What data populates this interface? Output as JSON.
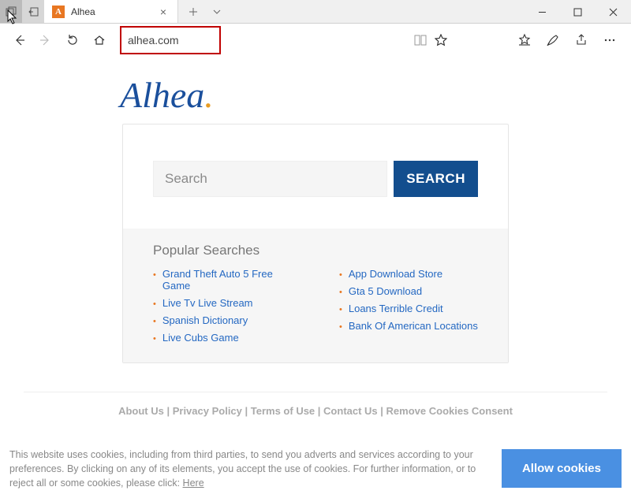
{
  "browser": {
    "tab": {
      "favicon_letter": "A",
      "title": "Alhea"
    },
    "url": "alhea.com"
  },
  "page": {
    "logo": {
      "text": "Alhea",
      "dot": "."
    },
    "search": {
      "placeholder": "Search",
      "button": "SEARCH"
    },
    "popular": {
      "title": "Popular Searches",
      "col1": [
        "Grand Theft Auto 5 Free Game",
        "Live Tv Live Stream",
        "Spanish Dictionary",
        "Live Cubs Game"
      ],
      "col2": [
        "App Download Store",
        "Gta 5 Download",
        "Loans Terrible Credit",
        "Bank Of American Locations"
      ]
    },
    "footer": {
      "links": [
        "About Us",
        "Privacy Policy",
        "Terms of Use",
        "Contact Us",
        "Remove Cookies Consent"
      ]
    },
    "cookie": {
      "text": "This website uses cookies, including from third parties, to send you adverts and services according to your preferences. By clicking on any of its elements, you accept the use of cookies. For further information, or to reject all or some cookies, please click:",
      "link": "Here",
      "button": "Allow cookies"
    }
  }
}
